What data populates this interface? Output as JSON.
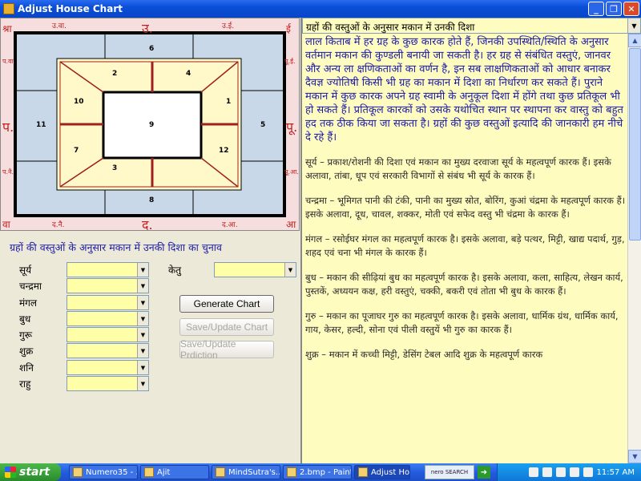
{
  "window": {
    "title": "Adjust House Chart",
    "buttons": {
      "minimize": "_",
      "maximize": "❐",
      "close": "✕"
    }
  },
  "chart": {
    "corners": {
      "top_left": "श्रा",
      "top_right": "ई",
      "bottom_left": "वा",
      "bottom_right": "आ"
    },
    "directions": {
      "top": "उ.",
      "bottom": "द.",
      "left": "प.",
      "right": "पू.",
      "top_left": "उ.वा.",
      "top_right": "उ.ई.",
      "bottom_left": "द.नै.",
      "bottom_right": "द.आ.",
      "left_upper": "प.वा.",
      "left_lower": "प.नै.",
      "right_upper": "पू.ई.",
      "right_lower": "पू.आ."
    },
    "houses": [
      "1",
      "2",
      "3",
      "4",
      "5",
      "6",
      "7",
      "8",
      "9",
      "10",
      "11",
      "12"
    ]
  },
  "form": {
    "title": "ग्रहों की वस्तुओं के अनुसार मकान में उनकी दिशा का चुनाव",
    "planets": [
      "सूर्य",
      "चन्द्रमा",
      "मंगल",
      "बुध",
      "गुरू",
      "शुक्र",
      "शनि",
      "राहु"
    ],
    "ketu_label": "केतु",
    "selected_values": [
      "",
      "",
      "",
      "",
      "",
      "",
      "",
      "",
      ""
    ],
    "generate_label": "Generate Chart",
    "save_label": "Save/Update Chart",
    "save_prediction_label": "Save/Update Prdiction"
  },
  "right_panel": {
    "header": "ग्रहों की वस्तुओं के अनुसार मकान में उनकी दिशा",
    "intro": "लाल किताब में हर ग्रह के कुछ कारक होते हैं, जिनकी उपस्थिति/स्थिति के अनुसार वर्तमान मकान की कुण्डली बनायी जा सकती है। हर ग्रह से संबंधित वस्तुएं, जानवर और अन्य ला क्षणिकताओं का वर्णन है, इन सब लाक्षणिकताओं को आधार बनाकर दैवज्ञ ज्योतिषी किसी भी ग्रह का मकान में दिशा का निर्धारण कर सकते हैं। पुराने मकान में कुछ कारक अपने ग्रह स्वामी के अनुकूल दिशा में होंगे तथा कुछ प्रतिकूल भी हो सकते हैं। प्रतिकूल कारकों को उसके यथोचित स्थान पर स्थापना कर वास्तु को बहुत हद तक ठीक किया जा सकता है। ग्रहों की कुछ वस्तुओं इत्यादि की जानकारी हम नीचे दे रहे हैं।",
    "paragraphs": [
      "सूर्य – प्रकाश/रोशनी की दिशा एवं मकान का मुख्य दरवाजा सूर्य के महत्वपूर्ण कारक हैं। इसके अलावा, तांबा, धूप एवं सरकारी विभागों से संबंध भी सूर्य के कारक हैं।",
      "चन्द्रमा – भूमिगत पानी की टंकी, पानी का मुख्य स्रोत, बोरिंग, कुआं चंद्रमा के महत्वपूर्ण कारक हैं। इसके अलावा, दूध, चावल, शक्कर, मोती एवं सफेद वस्तु भी चंद्रमा के कारक हैं।",
      "मंगल – रसोईघर मंगल का महत्वपूर्ण कारक है। इसके अलावा, बड़े पत्थर, मिट्टी, खाद्य पदार्थ, गुड़, शहद एवं चना भी मंगल के कारक हैं।",
      "बुध – मकान की सीढ़ियां बुध का महत्वपूर्ण कारक है। इसके अलावा, कला, साहित्य, लेखन कार्य, पुस्तकें, अध्ययन कक्ष, हरी वस्तुएं, चक्की, बकरी एवं तोता भी बुध के कारक हैं।",
      "गुरु – मकान का पूजाघर गुरु का महत्वपूर्ण कारक है। इसके अलावा, धार्मिक ग्रंथ, धार्मिक कार्य, गाय, केसर, हल्दी, सोना एवं पीली वस्तुयें भी गुरु का कारक हैं।",
      "शुक्र – मकान में कच्ची मिट्टी, डेसिंग टेबल आदि शुक्र के महत्वपूर्ण कारक"
    ]
  },
  "taskbar": {
    "start": "start",
    "tasks": [
      "Numero35 - ...",
      "Ajit",
      "MindSutra's...",
      "2.bmp - Paint",
      "Adjust Hous..."
    ],
    "nero": "nero SEARCH",
    "clock": "11:57 AM"
  },
  "colors": {
    "house_border": "#000000",
    "diagonal": "#a02020",
    "chart_bg": "#f7dede",
    "inner_bg": "#c8d8e8",
    "house_fill": "#fff8c8"
  }
}
